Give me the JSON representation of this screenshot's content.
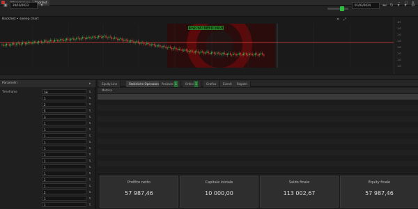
{
  "titlebar": {
    "tabs": [
      "Ottimizzazione",
      "Backtest"
    ],
    "active": 1
  },
  "toolbar": {
    "start_date": "20/10/2023",
    "end_date": "01/03/2024"
  },
  "chart": {
    "label": "Backtest • sweep chart",
    "price_badge": "57 957,46 | +3 097,55",
    "right_labels": [
      "1H",
      "1.0",
      "1.0",
      "1.0",
      "1.0",
      "1.0",
      "1.0",
      "1.0"
    ],
    "time_labels": [
      "",
      "",
      "",
      "",
      "",
      "",
      "",
      "",
      "",
      ""
    ],
    "colors": {
      "up": "#2fb84a",
      "down": "#d84040",
      "ref_line": "#e04040",
      "logo": "#c00000"
    }
  },
  "left_panel": {
    "title": "Parametri",
    "params": [
      {
        "label": "Timeframe",
        "value": "1H"
      },
      {
        "label": "",
        "value": "1"
      },
      {
        "label": "",
        "value": "2"
      },
      {
        "label": "",
        "value": "5"
      },
      {
        "label": "",
        "value": "3"
      },
      {
        "label": "",
        "value": "1"
      },
      {
        "label": "",
        "value": "1"
      },
      {
        "label": "",
        "value": "1"
      },
      {
        "label": "",
        "value": "1"
      },
      {
        "label": "",
        "value": "1"
      },
      {
        "label": "",
        "value": "1"
      },
      {
        "label": "",
        "value": "1"
      },
      {
        "label": "",
        "value": "1"
      },
      {
        "label": "",
        "value": "1"
      },
      {
        "label": "",
        "value": "2"
      },
      {
        "label": "",
        "value": "1"
      },
      {
        "label": "",
        "value": "2"
      },
      {
        "label": "",
        "value": "1"
      },
      {
        "label": "",
        "value": "1"
      }
    ]
  },
  "main_tabs": [
    {
      "label": "Equity Line",
      "count": ""
    },
    {
      "label": "Statistiche Operazioni",
      "count": ""
    },
    {
      "label": "Posizioni",
      "count": "1"
    },
    {
      "label": "Ordini",
      "count": "1"
    },
    {
      "label": "Grafico",
      "count": ""
    },
    {
      "label": "Eventi",
      "count": ""
    },
    {
      "label": "Registri",
      "count": ""
    }
  ],
  "table": {
    "headers": [
      "Metrica",
      "",
      "",
      ""
    ],
    "rows": [
      {
        "label": "",
        "v": [
          "",
          "",
          ""
        ],
        "sel": true
      },
      {
        "label": "",
        "v": [
          "",
          "",
          ""
        ]
      },
      {
        "label": "",
        "v": [
          "",
          "",
          ""
        ]
      },
      {
        "label": "",
        "v": [
          "",
          "",
          ""
        ]
      },
      {
        "label": "",
        "v": [
          "",
          "",
          ""
        ]
      },
      {
        "label": "",
        "v": [
          "",
          "",
          ""
        ]
      },
      {
        "label": "",
        "v": [
          "",
          "",
          ""
        ]
      },
      {
        "label": "",
        "v": [
          "",
          "",
          ""
        ]
      },
      {
        "label": "",
        "v": [
          "",
          "",
          ""
        ]
      },
      {
        "label": "",
        "v": [
          "",
          "",
          ""
        ]
      },
      {
        "label": "",
        "v": [
          "",
          "",
          ""
        ]
      },
      {
        "label": "",
        "v": [
          "",
          "",
          ""
        ]
      },
      {
        "label": "",
        "v": [
          "",
          "",
          ""
        ]
      },
      {
        "label": "",
        "v": [
          "",
          "",
          ""
        ]
      },
      {
        "label": "",
        "v": [
          "",
          "",
          ""
        ]
      }
    ]
  },
  "summary": [
    {
      "label": "Profitto netto",
      "value": "57 987,46"
    },
    {
      "label": "Capitale iniziale",
      "value": "10 000,00"
    },
    {
      "label": "Saldo finale",
      "value": "113 002,67"
    },
    {
      "label": "Equity finale",
      "value": "57 987,46"
    }
  ]
}
